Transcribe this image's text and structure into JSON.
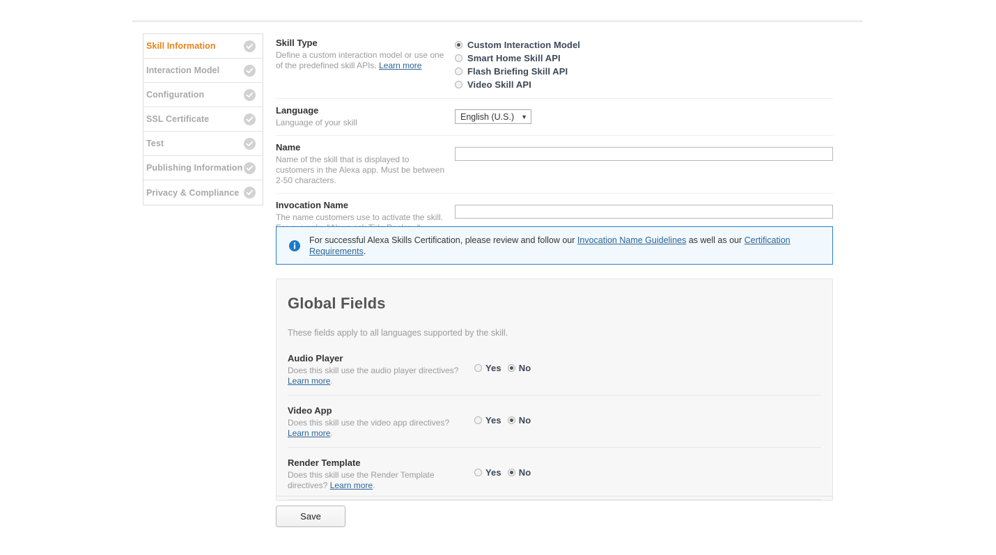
{
  "sidebar": {
    "items": [
      {
        "label": "Skill Information",
        "active": true,
        "icon": "check-circle-icon"
      },
      {
        "label": "Interaction Model",
        "active": false,
        "icon": "check-circle-icon"
      },
      {
        "label": "Configuration",
        "active": false,
        "icon": "check-circle-icon"
      },
      {
        "label": "SSL Certificate",
        "active": false,
        "icon": "check-circle-icon"
      },
      {
        "label": "Test",
        "active": false,
        "icon": "check-circle-icon"
      },
      {
        "label": "Publishing Information",
        "active": false,
        "icon": "check-circle-icon"
      },
      {
        "label": "Privacy & Compliance",
        "active": false,
        "icon": "check-circle-icon"
      }
    ]
  },
  "form": {
    "skill_type": {
      "title": "Skill Type",
      "desc_part1": "Define a custom interaction model or use one of the predefined skill APIs. ",
      "learn_more": "Learn more",
      "options": [
        {
          "label": "Custom Interaction Model",
          "selected": true
        },
        {
          "label": "Smart Home Skill API",
          "selected": false
        },
        {
          "label": "Flash Briefing Skill API",
          "selected": false
        },
        {
          "label": "Video Skill API",
          "selected": false
        }
      ]
    },
    "language": {
      "title": "Language",
      "desc": "Language of your skill",
      "selected": "English (U.S.)",
      "caret": "▼",
      "options": [
        "English (U.S.)"
      ]
    },
    "name": {
      "title": "Name",
      "desc": "Name of the skill that is displayed to customers in the Alexa app. Must be between 2-50 characters.",
      "value": "",
      "placeholder": ""
    },
    "invocation_name": {
      "title": "Invocation Name",
      "desc": "The name customers use to activate the skill. For example, \"Alexa ask Tide Pooler...\".",
      "value": "",
      "placeholder": ""
    }
  },
  "info_banner": {
    "icon": "info-circle-icon",
    "text_before": "For successful Alexa Skills Certification, please review and follow our ",
    "link1": "Invocation Name Guidelines",
    "text_middle": " as well as our ",
    "link2": "Certification Requirements",
    "text_after": ".",
    "border_color": "#2a7dc9",
    "background_color": "#f2f9fe"
  },
  "global_fields": {
    "title": "Global Fields",
    "subtitle": "These fields apply to all languages supported by the skill.",
    "rows": [
      {
        "title": "Audio Player",
        "desc": "Does this skill use the audio player directives? ",
        "link": "Learn more",
        "desc_after": ".",
        "yes_label": "Yes",
        "no_label": "No",
        "selected": "No"
      },
      {
        "title": "Video App",
        "desc": "Does this skill use the video app directives? ",
        "link": "Learn more",
        "desc_after": ".",
        "yes_label": "Yes",
        "no_label": "No",
        "selected": "No"
      },
      {
        "title": "Render Template",
        "desc": "Does this skill use the Render Template directives? ",
        "link": "Learn more",
        "desc_after": ".",
        "yes_label": "Yes",
        "no_label": "No",
        "selected": "No"
      }
    ]
  },
  "footer": {
    "save_label": "Save"
  },
  "colors": {
    "active_nav": "#e8821a",
    "muted_nav": "#a8a8a8",
    "link": "#2a6496",
    "info_blue": "#2a7dc9",
    "panel_bg": "#f7f7f7"
  }
}
